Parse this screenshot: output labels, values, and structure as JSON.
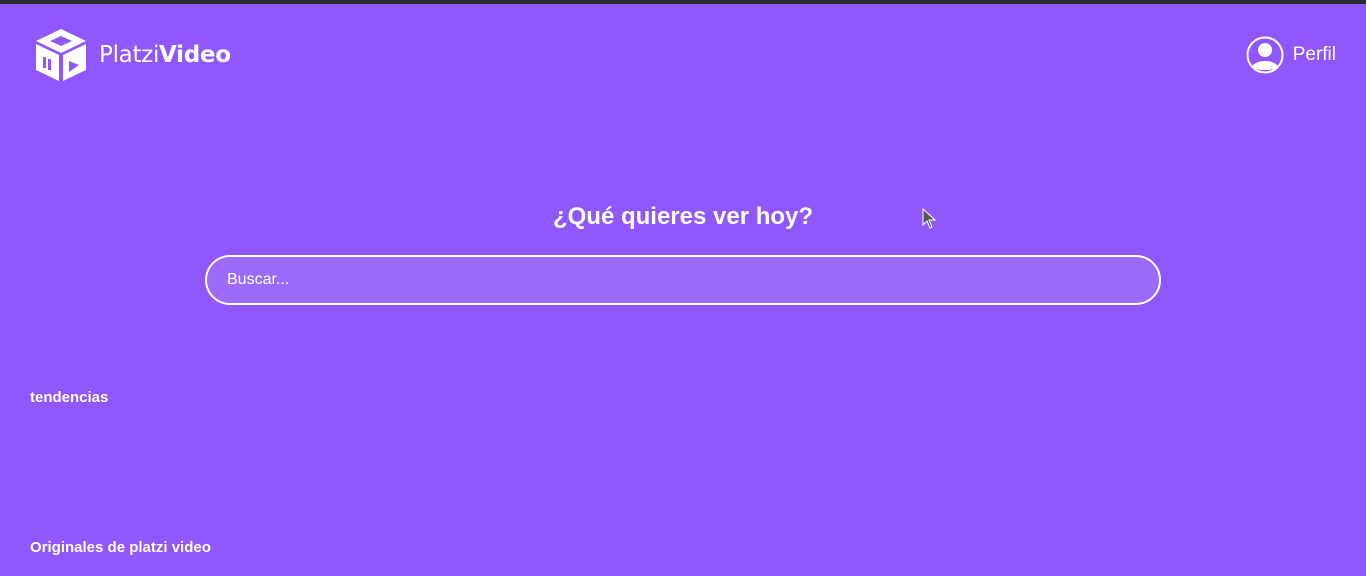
{
  "header": {
    "logo": {
      "light_text": "Platzi",
      "bold_text": "Video",
      "icon": "platzi-video-cube-icon"
    },
    "profile": {
      "label": "Perfil",
      "icon": "user-avatar-icon"
    }
  },
  "main": {
    "title": "¿Qué quieres ver hoy?",
    "search": {
      "placeholder": "Buscar...",
      "value": ""
    }
  },
  "sections": {
    "trends": "tendencias",
    "originals": "Originales de platzi video"
  },
  "colors": {
    "background": "#8f57fd",
    "text": "#ffffff",
    "top_strip": "#2b2b2b"
  }
}
